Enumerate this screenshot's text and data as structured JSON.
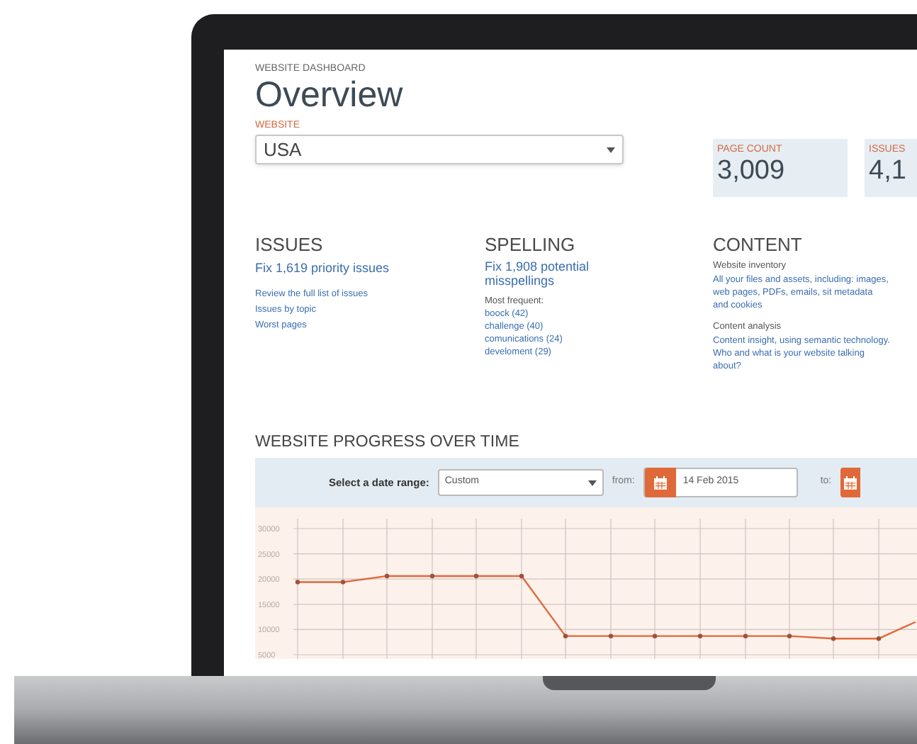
{
  "header": {
    "eyebrow": "WEBSITE DASHBOARD",
    "title": "Overview"
  },
  "website_select": {
    "label": "WEBSITE",
    "value": "USA"
  },
  "stats": [
    {
      "label": "PAGE COUNT",
      "value": "3,009"
    },
    {
      "label": "ISSUES",
      "value": "4,1"
    }
  ],
  "sections": [
    {
      "kind": "issues",
      "title": "ISSUES",
      "headline": "Fix 1,619 priority issues",
      "links": [
        "Review the full list of issues",
        "Issues by topic",
        "Worst pages"
      ]
    },
    {
      "kind": "spelling",
      "title": "SPELLING",
      "headline": "Fix 1,908 potential misspellings",
      "note": "Most frequent:",
      "links": [
        "boock (42)",
        "challenge (40)",
        "comunications (24)",
        "develoment (29)"
      ]
    },
    {
      "kind": "content",
      "title": "CONTENT",
      "groups": [
        {
          "label": "Website inventory",
          "text": "All your files and assets, including: images, web pages, PDFs, emails, sit metadata and cookies"
        },
        {
          "label": "Content analysis",
          "text": "Content insight, using semantic technology. Who and what is your website talking about?"
        }
      ]
    }
  ],
  "progress": {
    "title": "WEBSITE PROGRESS OVER TIME",
    "range_label": "Select a date range:",
    "range_value": "Custom",
    "from_label": "from:",
    "from_date": "14 Feb 2015",
    "to_label": "to:",
    "chart_data": {
      "type": "line",
      "grid": true,
      "yticks": [
        30000,
        25000,
        20000,
        15000,
        10000,
        5000
      ],
      "ylim": [
        5000,
        30000
      ],
      "series": [
        {
          "color": "#e0693a",
          "marker": true,
          "values": [
            19400,
            19400,
            20600,
            20600,
            20600,
            20600,
            8700,
            8700,
            8700,
            8700,
            8700,
            8700,
            8200,
            8200,
            11500
          ]
        }
      ]
    }
  }
}
